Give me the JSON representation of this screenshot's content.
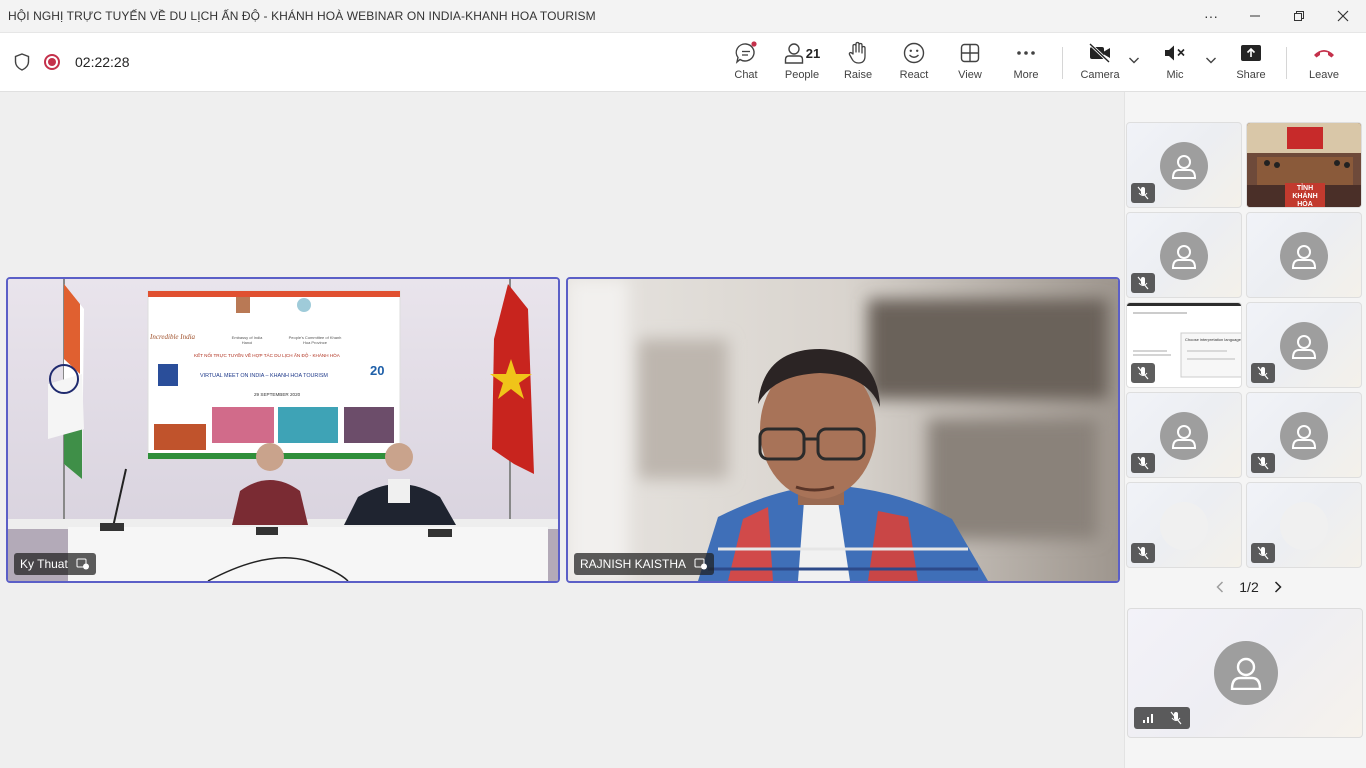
{
  "window": {
    "title": "HỘI NGHỊ TRỰC TUYẾN VỀ DU LỊCH ẤN ĐỘ - KHÁNH HOÀ WEBINAR ON INDIA-KHANH HOA TOURISM",
    "more": "···"
  },
  "toolbar": {
    "timer": "02:22:28",
    "chat_label": "Chat",
    "people_label": "People",
    "people_count": "21",
    "raise_label": "Raise",
    "react_label": "React",
    "view_label": "View",
    "more_label": "More",
    "camera_label": "Camera",
    "mic_label": "Mic",
    "share_label": "Share",
    "leave_label": "Leave",
    "leave_color": "#c4314b",
    "record_color": "#c4314b"
  },
  "stage": {
    "tiles": [
      {
        "name": "Ky Thuat",
        "slide": {
          "brand": "Incredible India",
          "embassy": "Embassy of India Hanoi",
          "committee": "People's Committee of Khanh Hoa Province",
          "headline_vi": "KẾT NỐI TRỰC TUYẾN VỀ HỢP TÁC DU LỊCH ẤN ĐỘ - KHÁNH HÒA",
          "headline_en": "VIRTUAL MEET ON INDIA – KHANH HOA TOURISM",
          "date": "29 SEPTEMBER 2020",
          "badge": "20"
        }
      },
      {
        "name": "RAJNISH KAISTHA"
      }
    ]
  },
  "gallery": {
    "room_sign": "TỈNH KHÁNH HÒA",
    "shared_heading": "Choose interpretation language",
    "pager": "1/2"
  },
  "colors": {
    "accent": "#5b5fc7"
  },
  "icons": [
    "shield-icon",
    "record-icon",
    "chat-icon",
    "people-icon",
    "raise-hand-icon",
    "react-icon",
    "view-icon",
    "more-icon",
    "camera-off-icon",
    "mic-off-icon",
    "share-icon",
    "leave-icon",
    "mic-muted-icon",
    "signal-icon",
    "chevron-left-icon",
    "chevron-right-icon",
    "pin-icon"
  ]
}
